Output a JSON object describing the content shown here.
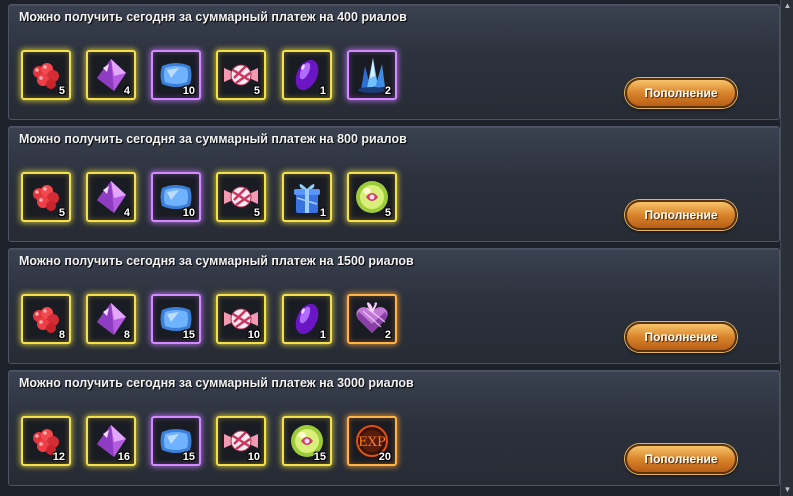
{
  "button_label": "Пополнение",
  "tiers": [
    {
      "title": "Можно получить сегодня за суммарный платеж на 400 риалов",
      "items": [
        {
          "icon": "red-berries-icon",
          "qty": "5",
          "frame": "gold"
        },
        {
          "icon": "purple-crystal-icon",
          "qty": "4",
          "frame": "gold"
        },
        {
          "icon": "blue-pillow-icon",
          "qty": "10",
          "frame": "purple"
        },
        {
          "icon": "candy-icon",
          "qty": "5",
          "frame": "gold"
        },
        {
          "icon": "purple-gem-icon",
          "qty": "1",
          "frame": "gold"
        },
        {
          "icon": "blue-crystal-shard-icon",
          "qty": "2",
          "frame": "purple"
        }
      ]
    },
    {
      "title": "Можно получить сегодня за суммарный платеж на 800 риалов",
      "items": [
        {
          "icon": "red-berries-icon",
          "qty": "5",
          "frame": "gold"
        },
        {
          "icon": "purple-crystal-icon",
          "qty": "4",
          "frame": "gold"
        },
        {
          "icon": "blue-pillow-icon",
          "qty": "10",
          "frame": "purple"
        },
        {
          "icon": "candy-icon",
          "qty": "5",
          "frame": "gold"
        },
        {
          "icon": "blue-gift-box-icon",
          "qty": "1",
          "frame": "gold"
        },
        {
          "icon": "green-orb-icon",
          "qty": "5",
          "frame": "gold"
        }
      ]
    },
    {
      "title": "Можно получить сегодня за суммарный платеж на 1500 риалов",
      "items": [
        {
          "icon": "red-berries-icon",
          "qty": "8",
          "frame": "gold"
        },
        {
          "icon": "purple-crystal-icon",
          "qty": "8",
          "frame": "gold"
        },
        {
          "icon": "blue-pillow-icon",
          "qty": "15",
          "frame": "purple"
        },
        {
          "icon": "candy-icon",
          "qty": "10",
          "frame": "gold"
        },
        {
          "icon": "purple-gem-icon",
          "qty": "1",
          "frame": "gold"
        },
        {
          "icon": "heart-gift-box-icon",
          "qty": "2",
          "frame": "orange"
        }
      ]
    },
    {
      "title": "Можно получить сегодня за суммарный платеж на 3000 риалов",
      "items": [
        {
          "icon": "red-berries-icon",
          "qty": "12",
          "frame": "gold"
        },
        {
          "icon": "purple-crystal-icon",
          "qty": "16",
          "frame": "gold"
        },
        {
          "icon": "blue-pillow-icon",
          "qty": "15",
          "frame": "purple"
        },
        {
          "icon": "candy-icon",
          "qty": "10",
          "frame": "gold"
        },
        {
          "icon": "green-orb-icon",
          "qty": "15",
          "frame": "gold"
        },
        {
          "icon": "exp-scroll-icon",
          "qty": "20",
          "frame": "orange",
          "icon_text": "EXP"
        }
      ]
    }
  ]
}
